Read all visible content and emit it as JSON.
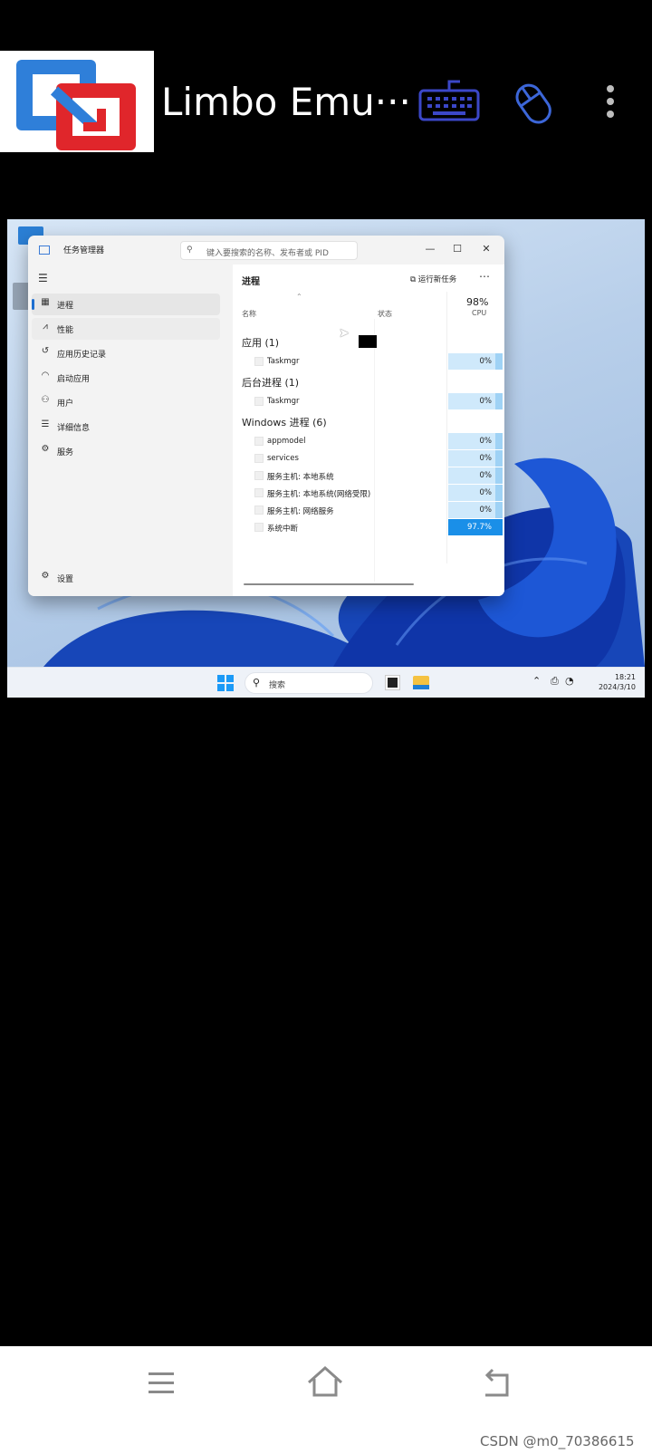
{
  "app_bar": {
    "title": "Limbo Emu···",
    "icons": [
      "limbo-logo-icon",
      "keyboard-icon",
      "mouse-icon",
      "more-vert-icon"
    ],
    "accent_color": "#3b47c8"
  },
  "task_manager": {
    "window_title": "任务管理器",
    "search_placeholder": "键入要搜索的名称、发布者或 PID",
    "controls": {
      "minimize": "—",
      "maximize": "☐",
      "close": "✕"
    },
    "sidebar": {
      "items": [
        {
          "label": "进程",
          "icon": "processes-icon",
          "active": true
        },
        {
          "label": "性能",
          "icon": "performance-icon"
        },
        {
          "label": "应用历史记录",
          "icon": "history-icon"
        },
        {
          "label": "启动应用",
          "icon": "startup-icon"
        },
        {
          "label": "用户",
          "icon": "users-icon"
        },
        {
          "label": "详细信息",
          "icon": "details-icon"
        },
        {
          "label": "服务",
          "icon": "services-icon"
        }
      ],
      "settings_label": "设置"
    },
    "content": {
      "title": "进程",
      "run_new_task": "运行新任务",
      "columns": {
        "name": "名称",
        "status": "状态",
        "cpu_label": "CPU",
        "cpu_total": "98%"
      },
      "groups": [
        {
          "title": "应用 (1)",
          "rows": [
            {
              "name": "Taskmgr",
              "cpu": "0%"
            }
          ]
        },
        {
          "title": "后台进程 (1)",
          "rows": [
            {
              "name": "Taskmgr",
              "cpu": "0%"
            }
          ]
        },
        {
          "title": "Windows 进程 (6)",
          "rows": [
            {
              "name": "appmodel",
              "cpu": "0%"
            },
            {
              "name": "services",
              "cpu": "0%"
            },
            {
              "name": "服务主机: 本地系统",
              "cpu": "0%"
            },
            {
              "name": "服务主机: 本地系统(网络受限)",
              "cpu": "0%"
            },
            {
              "name": "服务主机: 网络服务",
              "cpu": "0%"
            },
            {
              "name": "系统中断",
              "cpu": "97.7%",
              "hot": true
            }
          ]
        }
      ]
    }
  },
  "taskbar": {
    "search_text": "搜索",
    "time": "18:21",
    "date": "2024/3/10"
  },
  "watermark": "CSDN @m0_70386615"
}
